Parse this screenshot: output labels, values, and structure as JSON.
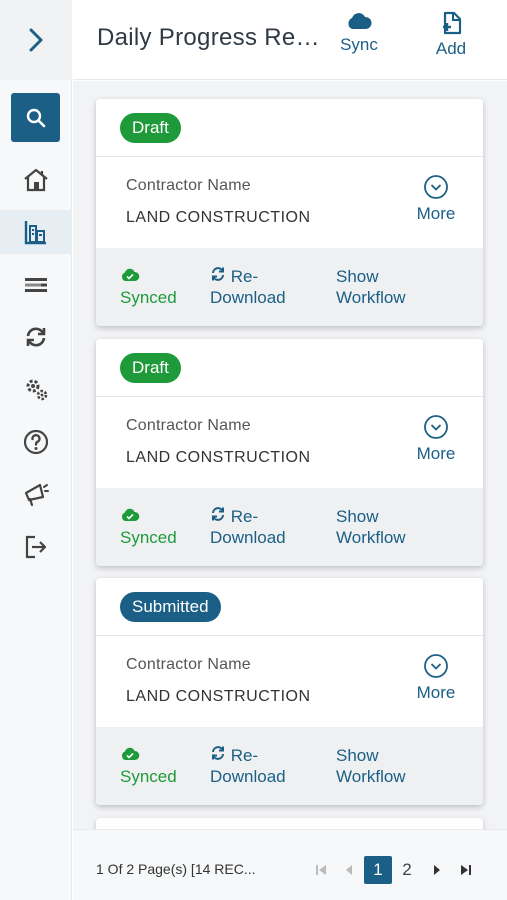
{
  "header": {
    "title": "Daily Progress Reports",
    "sync_label": "Sync",
    "add_label": "Add"
  },
  "sidebar": {
    "items": [
      {
        "name": "search"
      },
      {
        "name": "home"
      },
      {
        "name": "buildings"
      },
      {
        "name": "list"
      },
      {
        "name": "sync"
      },
      {
        "name": "settings"
      },
      {
        "name": "help"
      },
      {
        "name": "announcements"
      },
      {
        "name": "logout"
      }
    ]
  },
  "cards": [
    {
      "status": "Draft",
      "contractor_label": "Contractor Name",
      "contractor_value": "LAND CONSTRUCTION",
      "more_label": "More",
      "synced_label": "Synced",
      "redownload_label_1": "Re-",
      "redownload_label_2": "Download",
      "workflow_label_1": "Show",
      "workflow_label_2": "Workflow"
    },
    {
      "status": "Draft",
      "contractor_label": "Contractor Name",
      "contractor_value": "LAND CONSTRUCTION",
      "more_label": "More",
      "synced_label": "Synced",
      "redownload_label_1": "Re-",
      "redownload_label_2": "Download",
      "workflow_label_1": "Show",
      "workflow_label_2": "Workflow"
    },
    {
      "status": "Submitted",
      "contractor_label": "Contractor Name",
      "contractor_value": "LAND CONSTRUCTION",
      "more_label": "More",
      "synced_label": "Synced",
      "redownload_label_1": "Re-",
      "redownload_label_2": "Download",
      "workflow_label_1": "Show",
      "workflow_label_2": "Workflow"
    }
  ],
  "pagination": {
    "info": "1 Of 2 Page(s) [14 REC...",
    "pages": [
      "1",
      "2"
    ],
    "current": "1"
  },
  "colors": {
    "primary": "#1b5f86",
    "success": "#1f9a3a"
  }
}
